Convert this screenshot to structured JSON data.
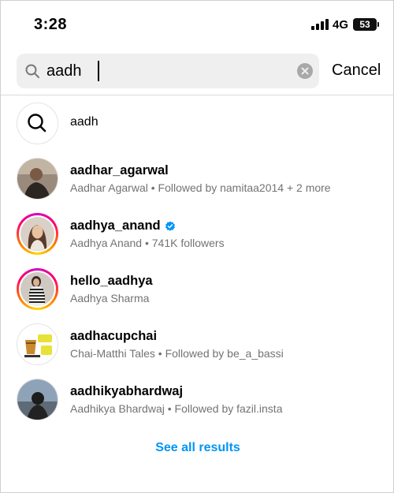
{
  "status_bar": {
    "time": "3:28",
    "network": "4G",
    "battery": "53"
  },
  "search": {
    "query": "aadh",
    "cancel_label": "Cancel"
  },
  "query_suggestion": {
    "text": "aadh"
  },
  "results": [
    {
      "username": "aadhar_agarwal",
      "subtitle": "Aadhar Agarwal • Followed by namitaa2014 + 2 more",
      "verified": false,
      "story_ring": false
    },
    {
      "username": "aadhya_anand",
      "subtitle": "Aadhya Anand • 741K followers",
      "verified": true,
      "story_ring": true
    },
    {
      "username": "hello_aadhya",
      "subtitle": "Aadhya Sharma",
      "verified": false,
      "story_ring": true
    },
    {
      "username": "aadhacupchai",
      "subtitle": "Chai-Matthi Tales • Followed by be_a_bassi",
      "verified": false,
      "story_ring": false
    },
    {
      "username": "aadhikyabhardwaj",
      "subtitle": "Aadhikya Bhardwaj • Followed by fazil.insta",
      "verified": false,
      "story_ring": false
    }
  ],
  "see_all_label": "See all results",
  "colors": {
    "link": "#0095f6",
    "verified": "#0095f6",
    "secondary_text": "#737373"
  }
}
